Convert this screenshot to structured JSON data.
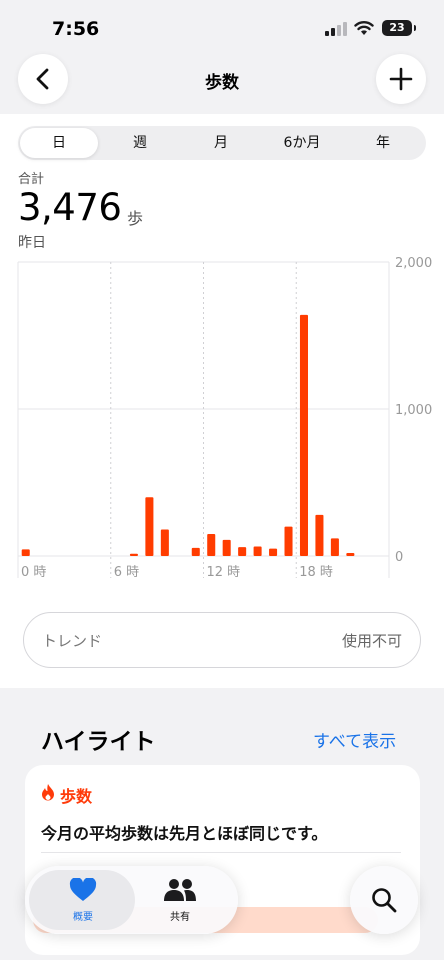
{
  "status_bar": {
    "time": "7:56",
    "battery": "23"
  },
  "nav": {
    "title": "歩数"
  },
  "segments": [
    {
      "label": "日",
      "active": true
    },
    {
      "label": "週",
      "active": false
    },
    {
      "label": "月",
      "active": false
    },
    {
      "label": "6か月",
      "active": false
    },
    {
      "label": "年",
      "active": false
    }
  ],
  "summary": {
    "label": "合計",
    "value": "3,476",
    "unit": "歩",
    "date": "昨日"
  },
  "chart_data": {
    "type": "bar",
    "x": [
      0,
      1,
      2,
      3,
      4,
      5,
      6,
      7,
      8,
      9,
      10,
      11,
      12,
      13,
      14,
      15,
      16,
      17,
      18,
      19,
      20,
      21,
      22,
      23
    ],
    "values": [
      45,
      0,
      0,
      0,
      0,
      0,
      0,
      15,
      400,
      180,
      0,
      55,
      150,
      110,
      60,
      65,
      50,
      200,
      1640,
      280,
      120,
      20,
      0,
      0
    ],
    "x_tick_labels": [
      "0 時",
      "6 時",
      "12 時",
      "18 時"
    ],
    "y_tick_labels": [
      "2,000",
      "1,000",
      "0"
    ],
    "ylim": [
      0,
      2000
    ],
    "bar_color": "#ff3c00"
  },
  "trend": {
    "label": "トレンド",
    "value": "使用不可"
  },
  "highlights": {
    "title": "ハイライト",
    "link": "すべて表示",
    "card": {
      "category": "歩数",
      "text": "今月の平均歩数は先月とほぼ同じです。"
    }
  },
  "tabbar": [
    {
      "label": "概要",
      "icon": "heart-icon",
      "active": true
    },
    {
      "label": "共有",
      "icon": "people-icon",
      "active": false
    }
  ],
  "colors": {
    "accent": "#ff3c00",
    "link": "#1a73e8",
    "tab_active": "#1a73e8"
  }
}
